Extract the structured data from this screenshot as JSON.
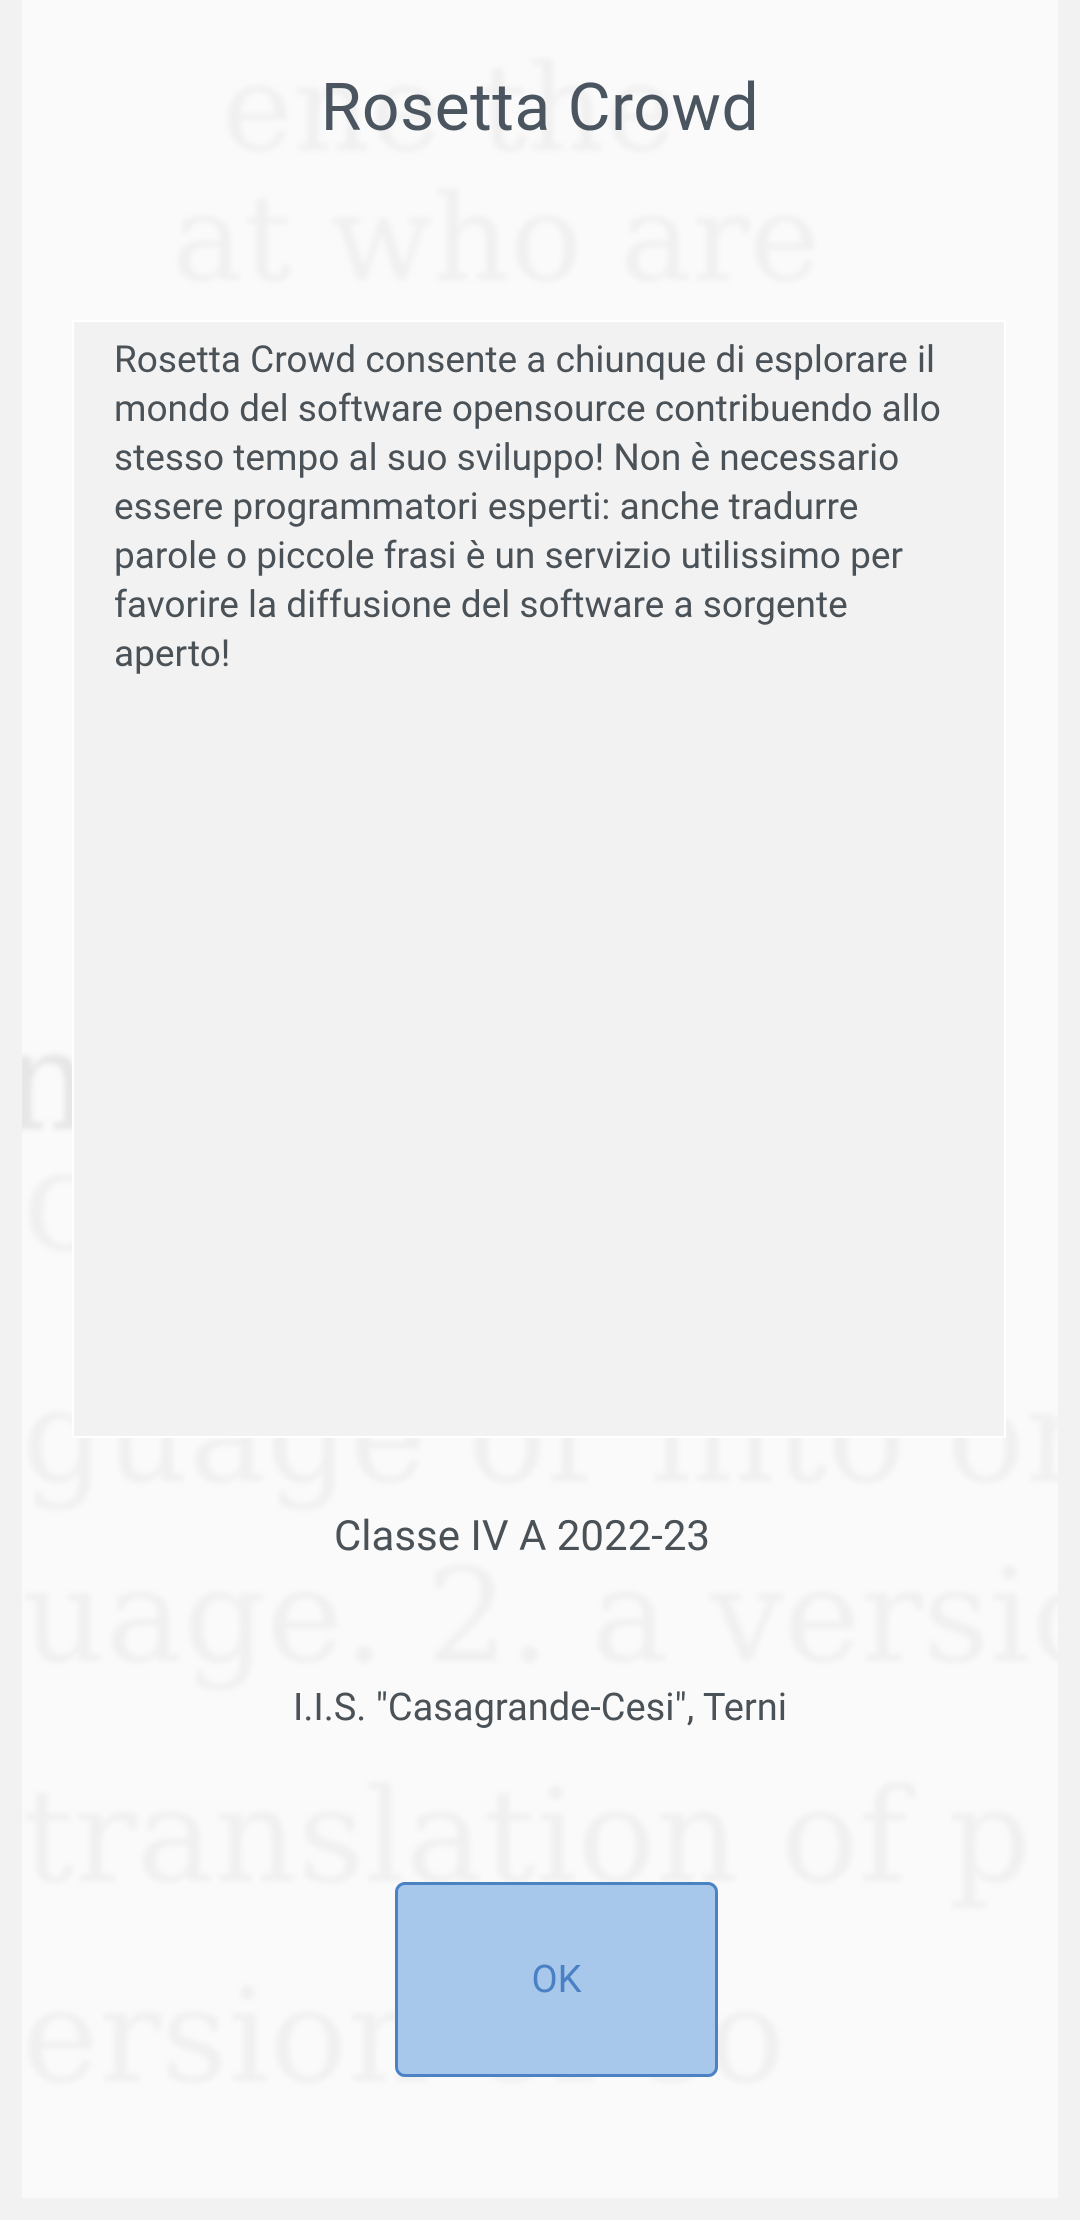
{
  "app": {
    "title": "Rosetta Crowd"
  },
  "about": {
    "description": "Rosetta Crowd consente a chiunque di esplorare il mondo del software opensource contribuendo allo stesso tempo al suo sviluppo! Non è necessario essere programmatori esperti: anche tradurre parole o piccole frasi è un servizio utilissimo per favorire la diffusione del software a sorgente aperto!",
    "class_label": "Classe IV A 2022-23",
    "school_label": "I.I.S. \"Casagrande-Cesi\", Terni"
  },
  "actions": {
    "ok_label": "OK"
  },
  "colors": {
    "page_background": "#fafafa",
    "text": "#4a5258",
    "button_fill": "#a8c8eb",
    "button_border": "#4a82c4"
  }
}
